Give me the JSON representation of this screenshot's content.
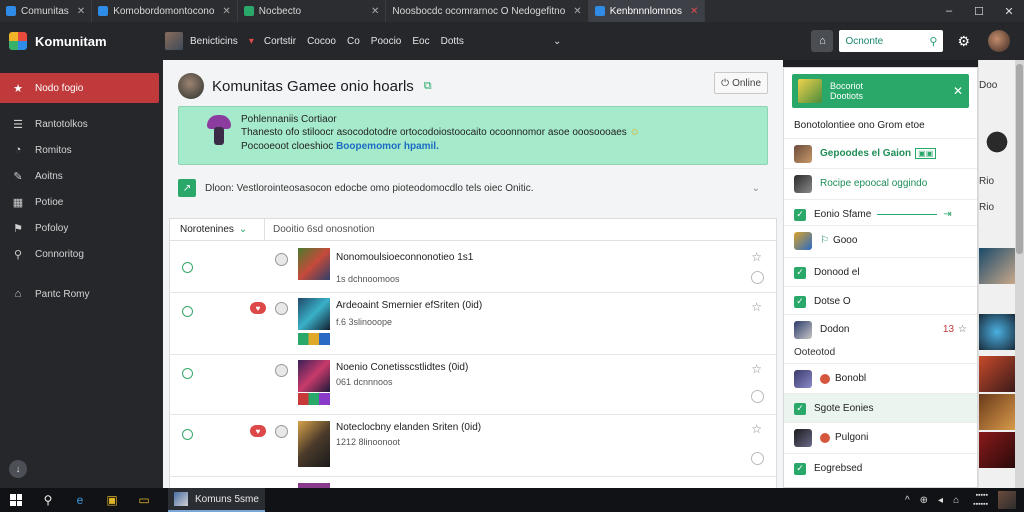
{
  "browser": {
    "tabs": [
      {
        "title": "Comunitas",
        "color": "#2e8be6",
        "active": false
      },
      {
        "title": "Komobordomontocono",
        "color": "#2e8be6",
        "active": false
      },
      {
        "title": "Nocbecto",
        "color": "#2aa86a",
        "active": false
      },
      {
        "title": "Noosbocdc ocomrarnoc O Nedogefitno",
        "color": "#444444",
        "active": false
      },
      {
        "title": "Kenbnnnlomnos",
        "color": "#2e8be6",
        "active": true
      }
    ],
    "window_controls": [
      "–",
      "☐",
      "✕"
    ]
  },
  "app": {
    "logo_text": "Komunitam",
    "nav_links": [
      "Benicticins",
      "Cortstir",
      "Cocoo",
      "Co",
      "Poocio",
      "Eoc",
      "Dotts"
    ],
    "nav_red": "▾",
    "nav_chevron": "⌄",
    "search": {
      "placeholder": "Ocnonte"
    }
  },
  "sidebar": {
    "items": [
      {
        "label": "Nodo fogio",
        "icon": "★",
        "active": true
      },
      {
        "label": "Rantotolkos",
        "icon": "☰",
        "active": false
      },
      {
        "label": "Romitos",
        "icon": "◔",
        "active": false
      },
      {
        "label": "Aoitns",
        "icon": "✎",
        "active": false
      },
      {
        "label": "Potioe",
        "icon": "▦",
        "active": false
      },
      {
        "label": "Pofoloy",
        "icon": "⚑",
        "active": false
      },
      {
        "label": "Connoritog",
        "icon": "⚲",
        "active": false
      },
      {
        "label": "Pantc Romy",
        "icon": "⌂",
        "active": false
      }
    ],
    "bottom_icon": "↓"
  },
  "main": {
    "title": "Komunitas Gamee onio hoarls",
    "online_label": "Online",
    "banner": {
      "title": "Pohlennaniis Cortiaor",
      "line1": "Thanesto ofo stiloocr asocodotodre ortocodoiostoocaito ocoonnomor asoe ooosoooaes",
      "line2_prefix": "Pocooeoot cloeshioc",
      "line2_link": "Boopemomor hpamil."
    },
    "notice": "Dloon: Vestlorointeosasocon edocbe omo pioteodomocdlo tels oiec Onitic.",
    "table": {
      "header_col1": "Norotenines",
      "header_col2": "Dooitio 6sd onosnotion",
      "rows": [
        {
          "name": "Nonomoulsioeconnonotieo 1s1",
          "meta": "1s dchnoomoos",
          "heart": false,
          "star": "☆"
        },
        {
          "name": "Ardeoaint Smernier efSriten (0id)",
          "meta": "f.6 3slinooope",
          "heart": true,
          "star": "☆"
        },
        {
          "name": "Noenio Conetisscstlidtes (0id)",
          "meta": "061 dcnnnoos",
          "heart": false,
          "star": "☆"
        },
        {
          "name": "Noteclocbny elanden Sriten (0id)",
          "meta": "1212 8linoonoot",
          "heart": true,
          "star": "☆"
        }
      ]
    }
  },
  "right_panel": {
    "header_title": "Bocoriot",
    "header_sub": "Dootiots",
    "subtitle": "Bonotolontiee ono Grom etoe",
    "items": [
      {
        "label": "Gepoodes el Gaion",
        "type": "avatar"
      },
      {
        "label": "Rocipe epoocal oggindo",
        "type": "avatar"
      },
      {
        "label": "Eonio Sfame",
        "type": "check"
      },
      {
        "label": "Gooo",
        "type": "avatar"
      },
      {
        "label": "Donood el",
        "type": "check"
      },
      {
        "label": "Dotse O",
        "type": "check"
      },
      {
        "label": "Dodon",
        "type": "avatar",
        "num": "13"
      },
      {
        "label": "Ooteotod",
        "type": "sub"
      },
      {
        "label": "Bonobl",
        "type": "avatar"
      },
      {
        "label": "Sgote Eonies",
        "type": "check"
      },
      {
        "label": "Pulgoni",
        "type": "avatar"
      },
      {
        "label": "Eogrebsed",
        "type": "check"
      }
    ]
  },
  "far_right": {
    "label1": "Doo",
    "label2": "Rio"
  },
  "taskbar": {
    "app_label": "Komuns 5sme",
    "tray": [
      "^",
      "⊕",
      "◂",
      "⌂"
    ]
  },
  "colors": {
    "accent_green": "#2aa86a",
    "active_red": "#c0393b",
    "banner_bg": "#a5eacb"
  }
}
